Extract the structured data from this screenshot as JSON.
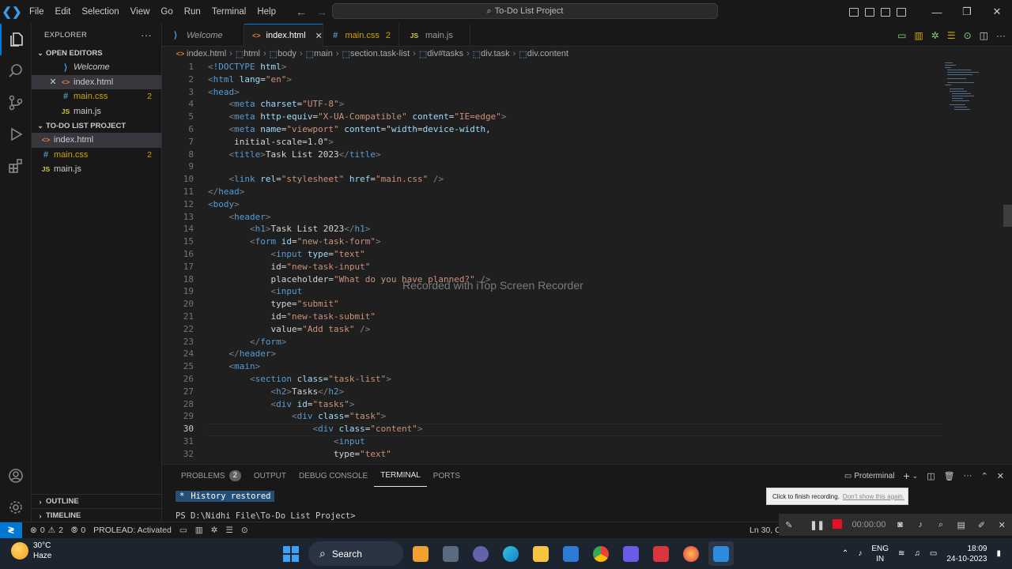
{
  "titlebar": {
    "menu": [
      "File",
      "Edit",
      "Selection",
      "View",
      "Go",
      "Run",
      "Terminal",
      "Help"
    ],
    "search": "To-Do List Project"
  },
  "sidebar": {
    "title": "EXPLORER",
    "open_editors_title": "OPEN EDITORS",
    "open_editors": [
      {
        "name": "Welcome",
        "type": "vscode"
      },
      {
        "name": "index.html",
        "type": "html"
      },
      {
        "name": "main.css",
        "type": "css",
        "count": "2"
      },
      {
        "name": "main.js",
        "type": "js"
      }
    ],
    "project_title": "TO-DO LIST PROJECT",
    "files": [
      {
        "name": "index.html",
        "type": "html"
      },
      {
        "name": "main.css",
        "type": "css",
        "count": "2"
      },
      {
        "name": "main.js",
        "type": "js"
      }
    ],
    "outline": "OUTLINE",
    "timeline": "TIMELINE"
  },
  "tabs": [
    {
      "name": "Welcome",
      "type": "vscode"
    },
    {
      "name": "index.html",
      "type": "html"
    },
    {
      "name": "main.css",
      "type": "css",
      "count": "2"
    },
    {
      "name": "main.js",
      "type": "js"
    }
  ],
  "breadcrumb": [
    "index.html",
    "html",
    "body",
    "main",
    "section.task-list",
    "div#tasks",
    "div.task",
    "div.content"
  ],
  "editor": {
    "current_line": 30,
    "line_numbers": [
      "1",
      "2",
      "3",
      "4",
      "5",
      "6",
      "7",
      "8",
      "9",
      "10",
      "11",
      "12",
      "13",
      "14",
      "15",
      "16",
      "17",
      "18",
      "19",
      "20",
      "21",
      "22",
      "23",
      "24",
      "25",
      "26",
      "27",
      "28",
      "29",
      "30",
      "31",
      "32"
    ],
    "lines": [
      "<!DOCTYPE html>",
      "<html lang=\"en\">",
      "<head>",
      "    <meta charset=\"UTF-8\">",
      "    <meta http-equiv=\"X-UA-Compatible\" content=\"IE=edge\">",
      "    <meta name=\"viewport\" content=\"width=device-width,",
      "     initial-scale=1.0\">",
      "    <title>Task List 2023</title>",
      "",
      "    <link rel=\"stylesheet\" href=\"main.css\" />",
      "</head>",
      "<body>",
      "    <header>",
      "        <h1>Task List 2023</h1>",
      "        <form id=\"new-task-form\">",
      "            <input type=\"text\"",
      "            id=\"new-task-input\"",
      "            placeholder=\"What do you have planned?\" />",
      "            <input",
      "            type=\"submit\"",
      "            id=\"new-task-submit\"",
      "            value=\"Add task\" />",
      "        </form>",
      "    </header>",
      "    <main>",
      "        <section class=\"task-list\">",
      "            <h2>Tasks</h2>",
      "            <div id=\"tasks\">",
      "                <div class=\"task\">",
      "                    <div class=\"content\">",
      "                        <input",
      "                        type=\"text\""
    ],
    "watermark": "Recorded with iTop Screen Recorder"
  },
  "panel": {
    "tabs": [
      "PROBLEMS",
      "OUTPUT",
      "DEBUG CONSOLE",
      "TERMINAL",
      "PORTS"
    ],
    "problems_count": "2",
    "active_tab": "TERMINAL",
    "terminal_name": "Proterminal",
    "terminal_lines": [
      "History restored",
      "PS D:\\Nidhi File\\To-Do List Project>"
    ]
  },
  "tooltip": {
    "text": "Click to finish recording.",
    "link": "Don't show this again."
  },
  "statusbar": {
    "errors": "0",
    "warnings": "2",
    "ports": "0",
    "prolead": "PROLEAD: Activated",
    "position": "Ln 30, C"
  },
  "recorder": {
    "time": "00:00:00"
  },
  "taskbar": {
    "temp": "30°C",
    "weather": "Haze",
    "search": "Search",
    "lang": "ENG",
    "region": "IN",
    "time": "18:09",
    "date": "24-10-2023"
  },
  "colors": {
    "accent": "#0078d4",
    "warning": "#cca700",
    "html_icon": "#e37933",
    "css_icon": "#519aba",
    "js_icon": "#cbcb41",
    "record": "#e81123"
  }
}
